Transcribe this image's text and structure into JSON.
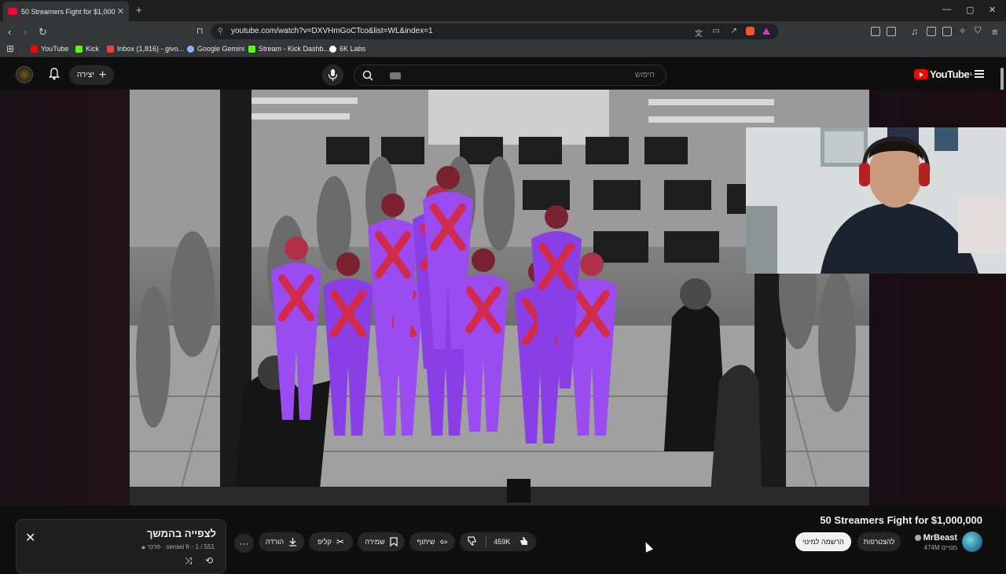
{
  "browser": {
    "tab_title": "50 Streamers Fight for $1,000,",
    "new_tab": "+",
    "window_controls": [
      "—",
      "▢",
      "✕"
    ],
    "url": "youtube.com/watch?v=DXVHmGoCTco&list=WL&index=1",
    "bookmarks": [
      {
        "label": "YouTube",
        "color": "#ff0000"
      },
      {
        "label": "Kick",
        "color": "#53fc18"
      },
      {
        "label": "Inbox (1,816) - givo...",
        "color": "#ea4335"
      },
      {
        "label": "Google Gemini",
        "color": "#8ab4f8"
      },
      {
        "label": "Stream - Kick Dashb...",
        "color": "#53fc18"
      },
      {
        "label": "6K Labs",
        "color": "#ffffff"
      }
    ]
  },
  "header": {
    "create_label": "יצירה",
    "search_placeholder": "חיפוש",
    "logo_text": "YouTube",
    "logo_country": "IL"
  },
  "video": {
    "title": "50 Streamers Fight for $1,000,000",
    "channel_name": "MrBeast",
    "channel_subs": "474M מנויים",
    "join_label": "להצטרפות",
    "subscribed_label": "הרשמה למינוי",
    "likes": "459K",
    "share_label": "שיתוף",
    "save_label": "שמירה",
    "clip_label": "קליפ",
    "download_label": "הורדה",
    "more_label": "···"
  },
  "playlist": {
    "title": "לצפייה בהמשך",
    "subtitle": "פרטי · sensei fr - 1 / 551"
  },
  "colors": {
    "accent": "#ff0000",
    "bg": "#0f0f0f",
    "pill": "#272727"
  }
}
